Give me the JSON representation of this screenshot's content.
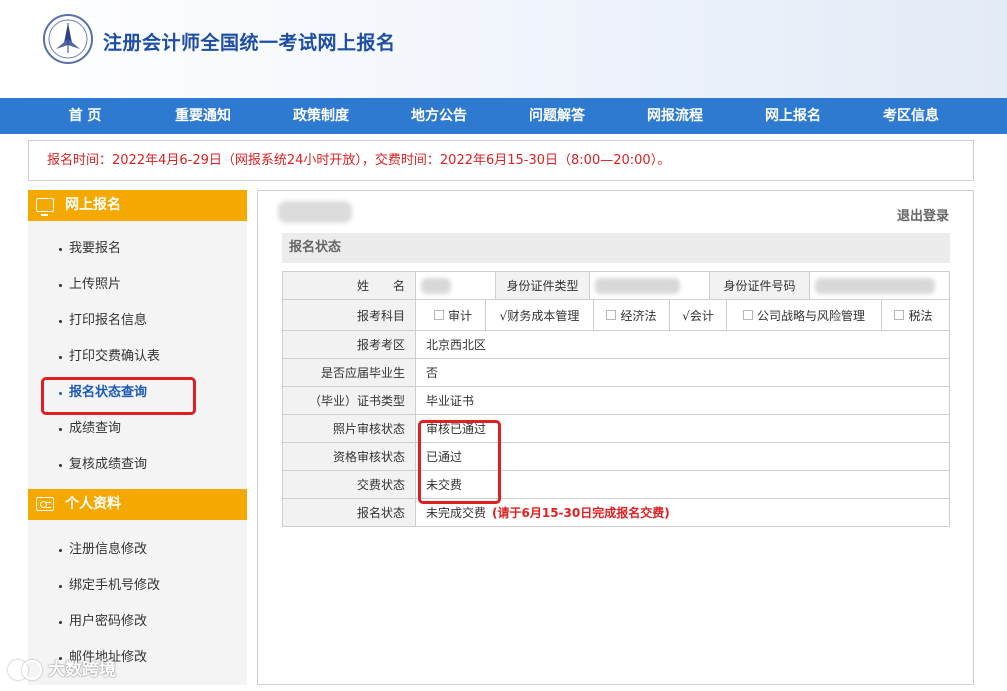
{
  "header": {
    "title": "注册会计师全国统一考试网上报名"
  },
  "nav": [
    "首 页",
    "重要通知",
    "政策制度",
    "地方公告",
    "问题解答",
    "网报流程",
    "网上报名",
    "考区信息"
  ],
  "notice": "报名时间：2022年4月6-29日（网报系统24小时开放），交费时间：2022年6月15-30日（8:00—20:00）。",
  "sidebar": {
    "section1": {
      "title": "网上报名",
      "items": [
        "我要报名",
        "上传照片",
        "打印报名信息",
        "打印交费确认表",
        "报名状态查询",
        "成绩查询",
        "复核成绩查询"
      ]
    },
    "section2": {
      "title": "个人资料",
      "items": [
        "注册信息修改",
        "绑定手机号修改",
        "用户密码修改",
        "邮件地址修改"
      ]
    }
  },
  "main": {
    "logout": "退出登录",
    "section_title": "报名状态",
    "labels": {
      "name": "姓　　名",
      "id_type": "身份证件类型",
      "id_number": "身份证件号码",
      "subjects": "报考科目",
      "exam_area": "报考考区",
      "graduate": "是否应届毕业生",
      "cert_type": "（毕业）证书类型",
      "photo_status": "照片审核状态",
      "qual_status": "资格审核状态",
      "payment_status": "交费状态",
      "reg_status": "报名状态"
    },
    "subjects": [
      {
        "name": "审计",
        "checked": false
      },
      {
        "name": "√财务成本管理",
        "checked": true
      },
      {
        "name": "经济法",
        "checked": false
      },
      {
        "name": "√会计",
        "checked": true
      },
      {
        "name": "公司战略与风险管理",
        "checked": false
      },
      {
        "name": "税法",
        "checked": false
      }
    ],
    "values": {
      "exam_area": "北京西北区",
      "graduate": "否",
      "cert_type": "毕业证书",
      "photo_status": "审核已通过",
      "qual_status": "已通过",
      "payment_status": "未交费",
      "reg_status": "未完成交费",
      "reg_hint": "(请于6月15-30日完成报名交费)"
    }
  },
  "watermark": "大数跨境"
}
